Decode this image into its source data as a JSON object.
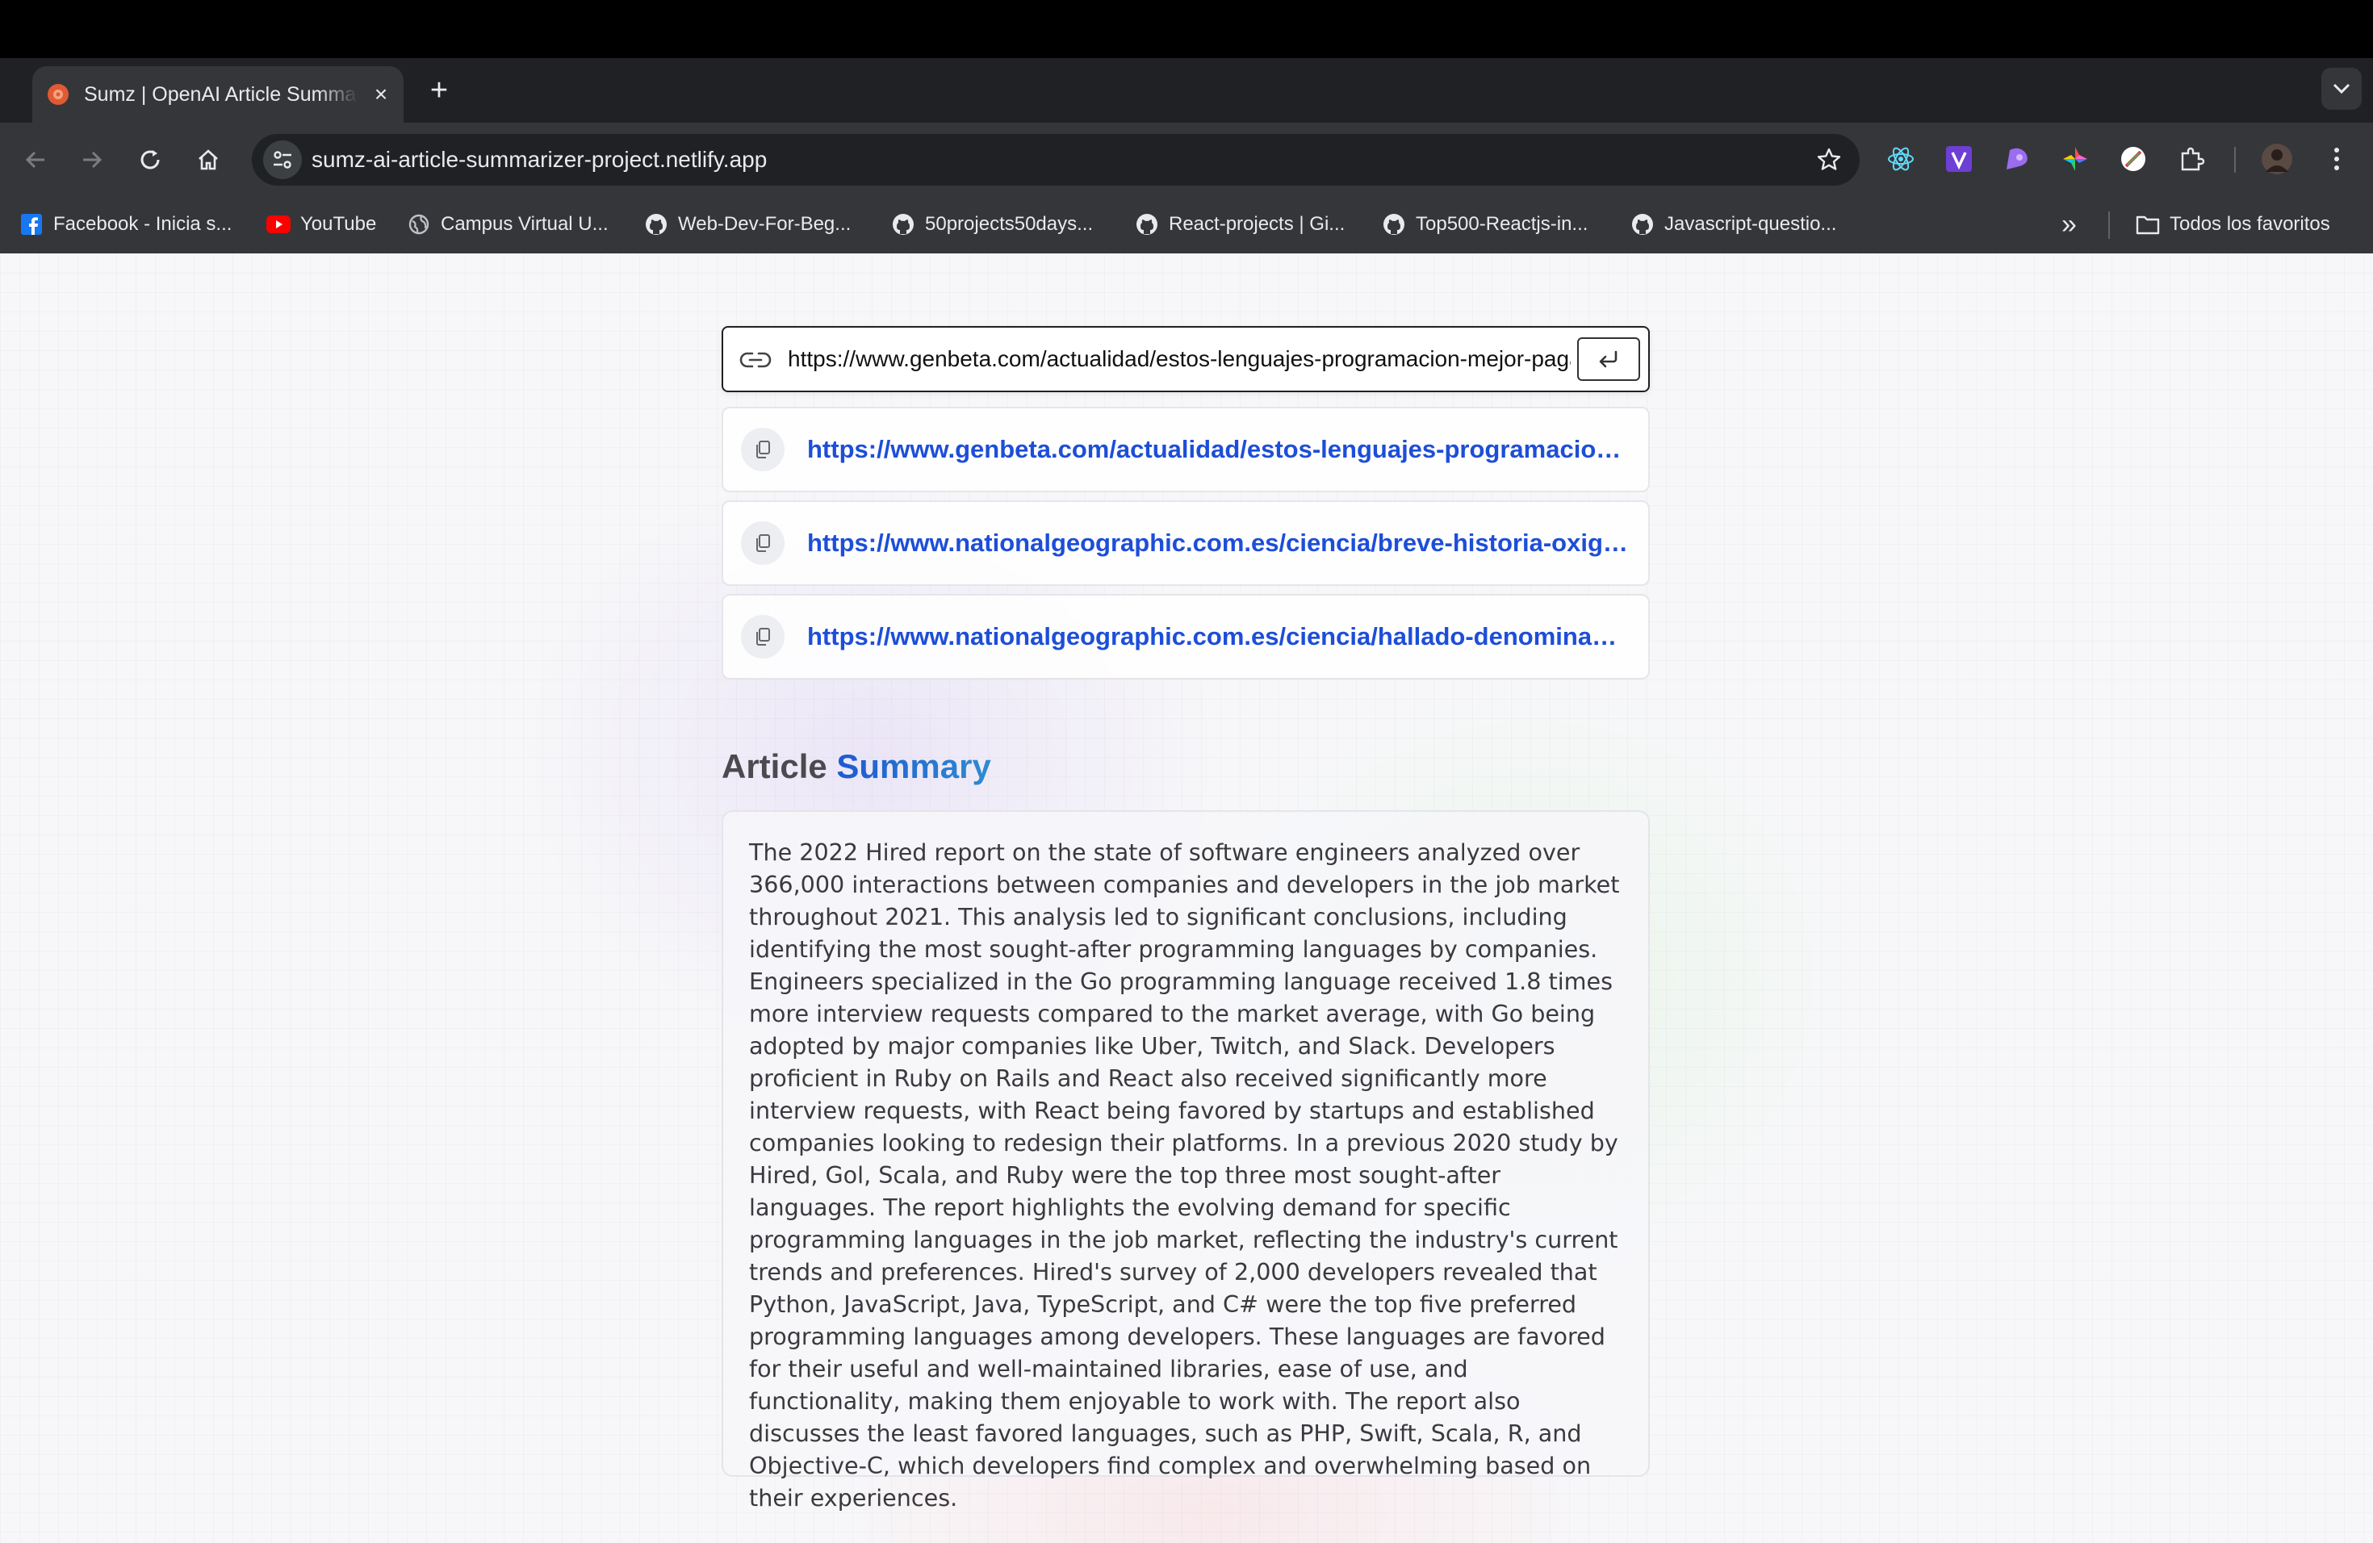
{
  "browser": {
    "tab": {
      "title": "Sumz | OpenAI Article Summarizer",
      "close_glyph": "×"
    },
    "new_tab_glyph": "+",
    "address": "sumz-ai-article-summarizer-project.netlify.app",
    "bookmarks": [
      {
        "label": "Facebook - Inicia s...",
        "icon": "facebook-icon"
      },
      {
        "label": "YouTube",
        "icon": "youtube-icon"
      },
      {
        "label": "Campus Virtual U...",
        "icon": "globe-icon"
      },
      {
        "label": "Web-Dev-For-Beg...",
        "icon": "github-icon"
      },
      {
        "label": "50projects50days...",
        "icon": "github-icon"
      },
      {
        "label": "React-projects | Gi...",
        "icon": "github-icon"
      },
      {
        "label": "Top500-Reactjs-in...",
        "icon": "github-icon"
      },
      {
        "label": "Javascript-questio...",
        "icon": "github-icon"
      }
    ],
    "overflow_glyph": "»",
    "all_bookmarks": "Todos los favoritos"
  },
  "app": {
    "url_input_value": "https://www.genbeta.com/actualidad/estos-lenguajes-programacion-mejor-pagados-mas-demandados-empresas",
    "history": [
      "https://www.genbeta.com/actualidad/estos-lenguajes-programacion-mejor-pagados-mas-demandados-empresas",
      "https://www.nationalgeographic.com.es/ciencia/breve-historia-oxigeno",
      "https://www.nationalgeographic.com.es/ciencia/hallado-denominado-planeta"
    ],
    "summary_heading_plain": "Article ",
    "summary_heading_accent": "Summary",
    "summary": "The 2022 Hired report on the state of software engineers analyzed over 366,000 interactions between companies and developers in the job market throughout 2021. This analysis led to significant conclusions, including identifying the most sought-after programming languages by companies. Engineers specialized in the Go programming language received 1.8 times more interview requests compared to the market average, with Go being adopted by major companies like Uber, Twitch, and Slack. Developers proficient in Ruby on Rails and React also received significantly more interview requests, with React being favored by startups and established companies looking to redesign their platforms. In a previous 2020 study by Hired, Gol, Scala, and Ruby were the top three most sought-after languages. The report highlights the evolving demand for specific programming languages in the job market, reflecting the industry's current trends and preferences. Hired's survey of 2,000 developers revealed that Python, JavaScript, Java, TypeScript, and C# were the top five preferred programming languages among developers. These languages are favored for their useful and well-maintained libraries, ease of use, and functionality, making them enjoyable to work with. The report also discusses the least favored languages, such as PHP, Swift, Scala, R, and Objective-C, which developers find complex and overwhelming based on their experiences."
  },
  "colors": {
    "accent": "#1d4ed8",
    "chrome_dark": "#202124",
    "chrome": "#35363a"
  }
}
